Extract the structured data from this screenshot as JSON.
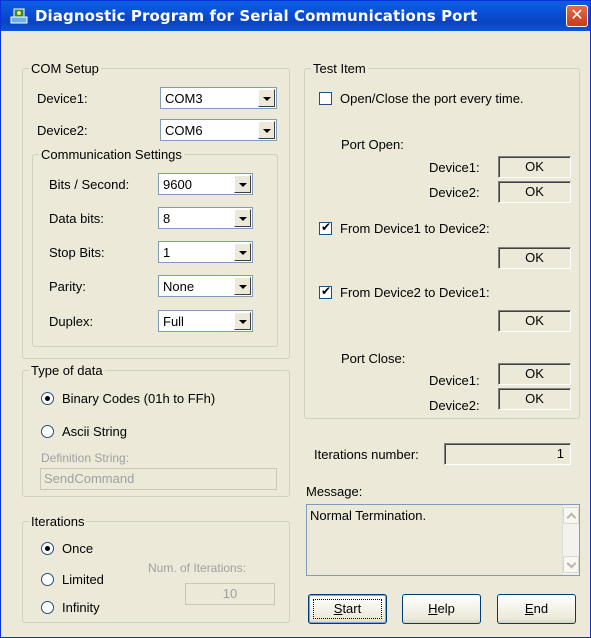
{
  "window": {
    "title": "Diagnostic Program for Serial Communications Port",
    "icon": "network-computer-icon",
    "close_icon": "close-icon",
    "accent": "#0a4fd6",
    "close_color": "#c53a1a"
  },
  "com_setup": {
    "legend": "COM Setup",
    "device1_label": "Device1:",
    "device1_value": "COM3",
    "device2_label": "Device2:",
    "device2_value": "COM6",
    "comm_settings": {
      "legend": "Communication Settings",
      "bits_label": "Bits / Second:",
      "bits_value": "9600",
      "data_label": "Data bits:",
      "data_value": "8",
      "stop_label": "Stop Bits:",
      "stop_value": "1",
      "parity_label": "Parity:",
      "parity_value": "None",
      "duplex_label": "Duplex:",
      "duplex_value": "Full"
    }
  },
  "type_of_data": {
    "legend": "Type of data",
    "binary_label": "Binary Codes (01h to FFh)",
    "binary_selected": true,
    "ascii_label": "Ascii String",
    "ascii_selected": false,
    "definition_label": "Definition String:",
    "definition_value": "SendCommand"
  },
  "iterations": {
    "legend": "Iterations",
    "once_label": "Once",
    "once_selected": true,
    "limited_label": "Limited",
    "infinity_label": "Infinity",
    "num_label": "Num. of Iterations:",
    "num_value": "10"
  },
  "test_item": {
    "legend": "Test Item",
    "open_close_label": "Open/Close the port every time.",
    "open_close_checked": false,
    "port_open_label": "Port Open:",
    "port_open_device1_label": "Device1:",
    "port_open_device1_status": "OK",
    "port_open_device2_label": "Device2:",
    "port_open_device2_status": "OK",
    "d1_to_d2_label": "From Device1 to Device2:",
    "d1_to_d2_checked": true,
    "d1_to_d2_status": "OK",
    "d2_to_d1_label": "From Device2 to Device1:",
    "d2_to_d1_checked": true,
    "d2_to_d1_status": "OK",
    "port_close_label": "Port Close:",
    "port_close_device1_label": "Device1:",
    "port_close_device1_status": "OK",
    "port_close_device2_label": "Device2:",
    "port_close_device2_status": "OK"
  },
  "iterations_number": {
    "label": "Iterations number:",
    "value": "1"
  },
  "message": {
    "label": "Message:",
    "text": "Normal Termination."
  },
  "buttons": {
    "start_key": "S",
    "start_rest": "tart",
    "help_key": "H",
    "help_rest": "elp",
    "end_key": "E",
    "end_rest": "nd"
  }
}
